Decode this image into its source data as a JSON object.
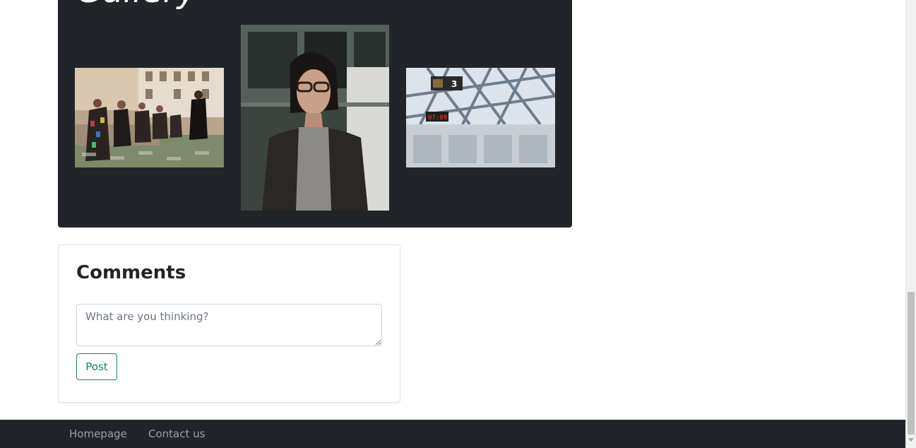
{
  "gallery": {
    "title": "Gallery",
    "photos": [
      {
        "alt": "Musicians in capes playing guitars in a town square"
      },
      {
        "alt": "Woman with glasses by a window"
      },
      {
        "alt": "Train station roof with display showing 3 and 07:09",
        "sign_number": "3",
        "clock": "07:09"
      }
    ]
  },
  "comments": {
    "title": "Comments",
    "placeholder": "What are you thinking?",
    "post_label": "Post"
  },
  "footer": {
    "links": [
      "Homepage",
      "Contact us"
    ]
  },
  "colors": {
    "dark": "#212529",
    "accent": "#198754",
    "muted": "#6c757d"
  }
}
